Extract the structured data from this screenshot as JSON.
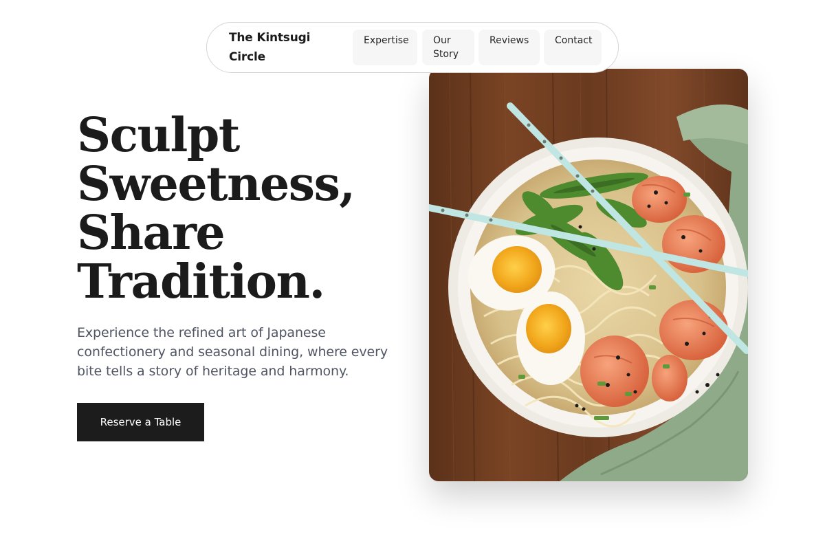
{
  "nav": {
    "brand": "The Kintsugi Circle",
    "links": [
      "Expertise",
      "Our Story",
      "Reviews",
      "Contact"
    ]
  },
  "hero": {
    "headline_lines": [
      "Sculpt",
      "Sweetness,",
      "Share",
      "Tradition."
    ],
    "description": "Experience the refined art of Japanese confectionery and seasonal dining, where every bite tells a story of heritage and harmony.",
    "cta_label": "Reserve a Table",
    "image": {
      "subject": "ramen-bowl-photo",
      "accent_colors": {
        "wood": "#6a3a1f",
        "napkin": "#8faa88",
        "chopsticks": "#bfe6e2",
        "yolk": "#f2a81d"
      }
    }
  },
  "colors": {
    "text_primary": "#1b1b1b",
    "text_secondary": "#4f5563",
    "button_bg": "#1c1c1c",
    "nav_chip_bg": "#f6f6f6"
  }
}
